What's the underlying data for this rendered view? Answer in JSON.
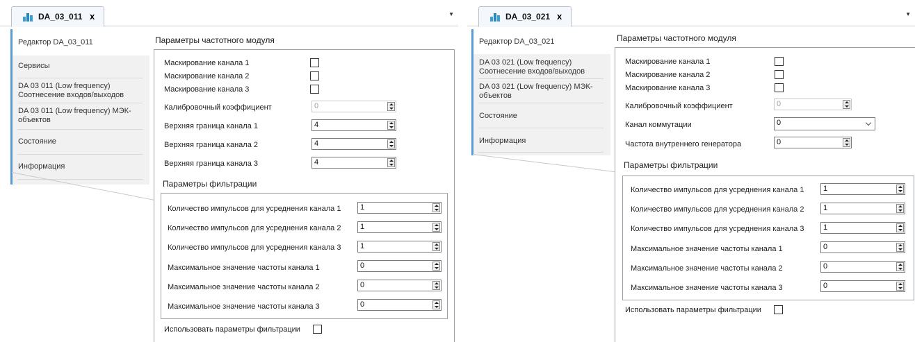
{
  "left": {
    "tab_title": "DA_03_011",
    "tab_close": "x",
    "dropdown": "▼",
    "nav": [
      "Редактор DA_03_011",
      "Сервисы",
      "DA 03 011 (Low frequency)\nСоотнесение входов/выходов",
      "DA 03 011 (Low frequency) МЭК-\nобъектов",
      "Состояние",
      "Информация"
    ],
    "section_title": "Параметры частотного модуля",
    "mask1": "Маскирование канала 1",
    "mask2": "Маскирование канала 2",
    "mask3": "Маскирование канала 3",
    "calib_label": "Калибровочный коэффициент",
    "calib_value": "0",
    "upper1_label": "Верхняя граница канала 1",
    "upper1_value": "4",
    "upper2_label": "Верхняя граница канала 2",
    "upper2_value": "4",
    "upper3_label": "Верхняя граница канала 3",
    "upper3_value": "4",
    "filter_title": "Параметры фильтрации",
    "pulses1_label": "Количество импульсов для усреднения канала 1",
    "pulses1_value": "1",
    "pulses2_label": "Количество импульсов для усреднения канала 2",
    "pulses2_value": "1",
    "pulses3_label": "Количество импульсов для усреднения канала 3",
    "pulses3_value": "1",
    "maxfreq1_label": "Максимальное значение частоты канала 1",
    "maxfreq1_value": "0",
    "maxfreq2_label": "Максимальное значение частоты канала 2",
    "maxfreq2_value": "0",
    "maxfreq3_label": "Максимальное значение частоты канала 3",
    "maxfreq3_value": "0",
    "use_filter_label": "Использовать параметры фильтрации"
  },
  "right": {
    "tab_title": "DA_03_021",
    "tab_close": "x",
    "dropdown": "▼",
    "nav": [
      "Редактор DA_03_021",
      "DA 03 021 (Low frequency)\nСоотнесение входов/выходов",
      "DA 03 021 (Low frequency) МЭК-\nобъектов",
      "Состояние",
      "Информация"
    ],
    "section_title": "Параметры частотного модуля",
    "mask1": "Маскирование канала 1",
    "mask2": "Маскирование канала 2",
    "mask3": "Маскирование канала 3",
    "calib_label": "Калибровочный коэффициент",
    "calib_value": "0",
    "commut_label": "Канал коммутации",
    "commut_value": "0",
    "gen_label": "Частота внутреннего генератора",
    "gen_value": "0",
    "filter_title": "Параметры фильтрации",
    "pulses1_label": "Количество импульсов для усреднения канала 1",
    "pulses1_value": "1",
    "pulses2_label": "Количество импульсов для усреднения канала 2",
    "pulses2_value": "1",
    "pulses3_label": "Количество импульсов для усреднения канала 3",
    "pulses3_value": "1",
    "maxfreq1_label": "Максимальное значение частоты канала 1",
    "maxfreq1_value": "0",
    "maxfreq2_label": "Максимальное значение частоты канала 2",
    "maxfreq2_value": "0",
    "maxfreq3_label": "Максимальное значение частоты канала 3",
    "maxfreq3_value": "0",
    "use_filter_label": "Использовать параметры фильтрации"
  }
}
